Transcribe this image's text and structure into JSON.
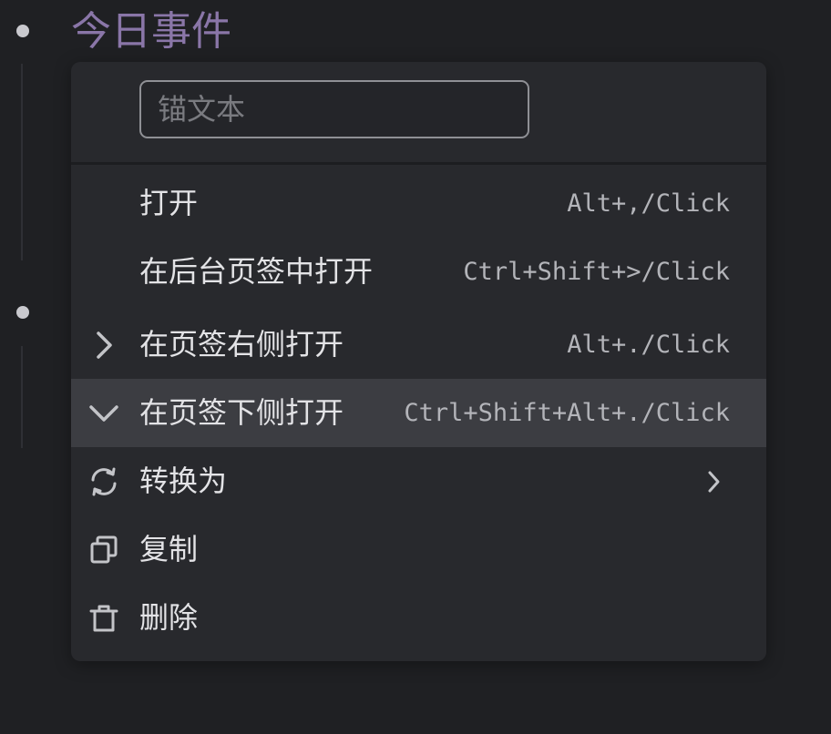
{
  "page": {
    "heading": "今日事件"
  },
  "context_menu": {
    "anchor_input": {
      "value": "",
      "placeholder": "锚文本"
    },
    "items": [
      {
        "label": "打开",
        "shortcut": "Alt+,/Click",
        "icon": ""
      },
      {
        "label": "在后台页签中打开",
        "shortcut": "Ctrl+Shift+>/Click",
        "icon": ""
      },
      {
        "label": "在页签右侧打开",
        "shortcut": "Alt+./Click",
        "icon": "chevron-right-icon"
      },
      {
        "label": "在页签下侧打开",
        "shortcut": "Ctrl+Shift+Alt+./Click",
        "icon": "chevron-down-icon",
        "highlighted": true
      },
      {
        "label": "转换为",
        "shortcut": "",
        "icon": "refresh-icon",
        "has_submenu": true
      },
      {
        "label": "复制",
        "shortcut": "",
        "icon": "copy-icon"
      },
      {
        "label": "删除",
        "shortcut": "",
        "icon": "trash-icon"
      }
    ]
  },
  "colors": {
    "background": "#1f2023",
    "menu_background": "#28292d",
    "highlight": "#3c3d42",
    "heading": "#8a76a8"
  }
}
